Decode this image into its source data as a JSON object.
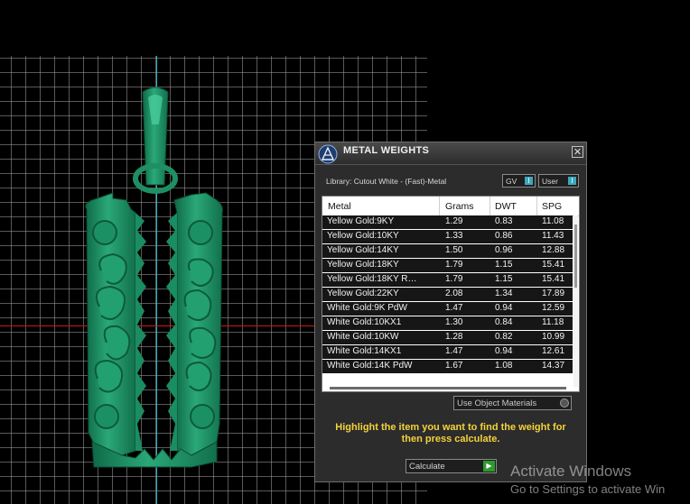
{
  "dialog": {
    "title": "METAL WEIGHTS",
    "library_label": "Library: Cutout White - (Fast)-Metal",
    "toggles": [
      {
        "label": "GV",
        "knob": "I"
      },
      {
        "label": "User",
        "knob": "I"
      }
    ],
    "close_glyph": "✕",
    "table": {
      "columns": [
        "Metal",
        "Grams",
        "DWT",
        "SPG"
      ],
      "rows": [
        {
          "metal": "Yellow Gold:9KY",
          "grams": "1.29",
          "dwt": "0.83",
          "spg": "11.08"
        },
        {
          "metal": "Yellow Gold:10KY",
          "grams": "1.33",
          "dwt": "0.86",
          "spg": "11.43"
        },
        {
          "metal": "Yellow Gold:14KY",
          "grams": "1.50",
          "dwt": "0.96",
          "spg": "12.88"
        },
        {
          "metal": "Yellow Gold:18KY",
          "grams": "1.79",
          "dwt": "1.15",
          "spg": "15.41"
        },
        {
          "metal": "Yellow Gold:18KY R…",
          "grams": "1.79",
          "dwt": "1.15",
          "spg": "15.41"
        },
        {
          "metal": "Yellow Gold:22KY",
          "grams": "2.08",
          "dwt": "1.34",
          "spg": "17.89"
        },
        {
          "metal": "White Gold:9K PdW",
          "grams": "1.47",
          "dwt": "0.94",
          "spg": "12.59"
        },
        {
          "metal": "White Gold:10KX1",
          "grams": "1.30",
          "dwt": "0.84",
          "spg": "11.18"
        },
        {
          "metal": "White Gold:10KW",
          "grams": "1.28",
          "dwt": "0.82",
          "spg": "10.99"
        },
        {
          "metal": "White Gold:14KX1",
          "grams": "1.47",
          "dwt": "0.94",
          "spg": "12.61"
        },
        {
          "metal": "White Gold:14K PdW",
          "grams": "1.67",
          "dwt": "1.08",
          "spg": "14.37"
        }
      ]
    },
    "materials_dropdown": "Use Object Materials",
    "instruction": "Highlight the item you want to find the weight for then press calculate.",
    "calculate_button": "Calculate",
    "calculate_icon": "▶"
  },
  "watermark": {
    "title": "Activate Windows",
    "subtitle": "Go to Settings to activate Win"
  },
  "colors": {
    "model": "#1f9a6e",
    "accent": "#3ea7bb",
    "instruction": "#f4d23a",
    "axis_x": "#c81818",
    "axis_y": "#27b3c3"
  },
  "icons": {
    "app_logo": "app-logo-icon",
    "close": "close-icon",
    "dropdown": "dropdown-icon",
    "go": "play-arrow-icon"
  }
}
